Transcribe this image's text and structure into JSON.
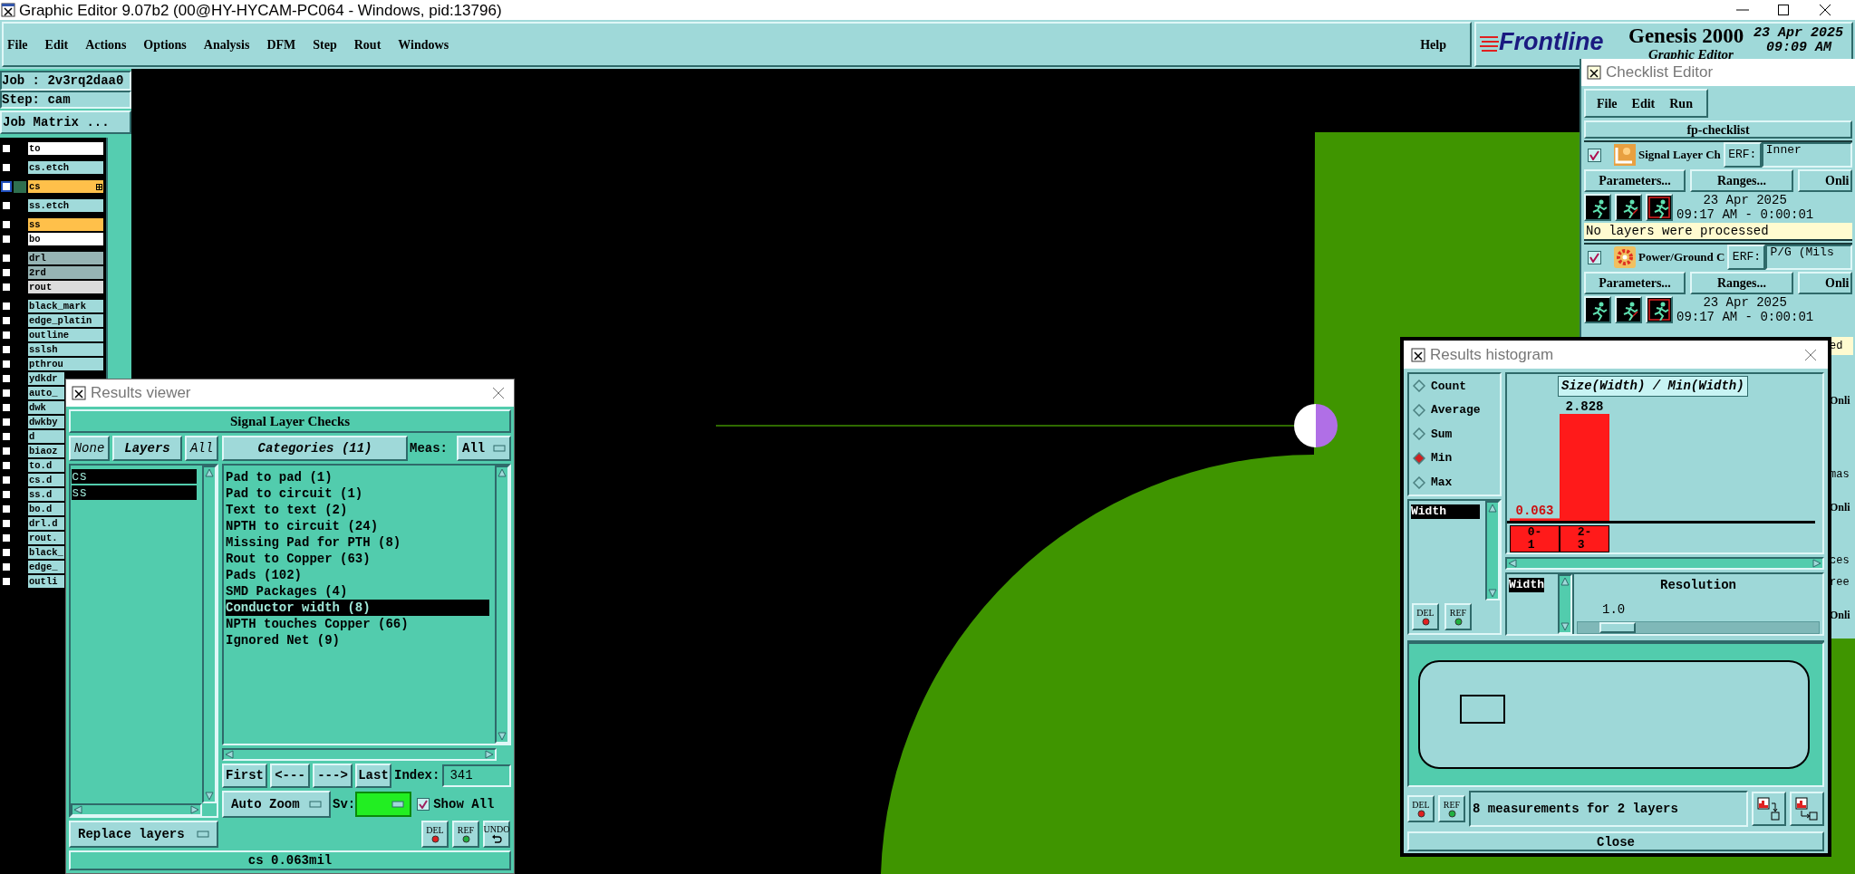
{
  "window": {
    "title": "Graphic Editor 9.07b2 (00@HY-HYCAM-PC064 - Windows, pid:13796)"
  },
  "menu": [
    "File",
    "Edit",
    "Actions",
    "Options",
    "Analysis",
    "DFM",
    "Step",
    "Rout",
    "Windows"
  ],
  "help": "Help",
  "brand": {
    "logo": "Frontline",
    "product": "Genesis 2000",
    "subtitle": "Graphic Editor",
    "date": "23 Apr 2025",
    "time": "09:09 AM"
  },
  "job": {
    "job": "Job : 2v3rq2daa0",
    "step": "Step: cam",
    "matrix_button": "Job Matrix ..."
  },
  "layer_groups": [
    [
      {
        "name": "to",
        "color": "#ffffff",
        "active": false,
        "checked": false
      }
    ],
    [
      {
        "name": "cs.etch",
        "color": "#a0dada",
        "active": false,
        "checked": false
      }
    ],
    [
      {
        "name": "cs",
        "color": "#ffc04a",
        "active": true,
        "checked": false
      }
    ],
    [
      {
        "name": "ss.etch",
        "color": "#a0dada",
        "active": false,
        "checked": false
      }
    ],
    [
      {
        "name": "ss",
        "color": "#ffc04a",
        "active": false,
        "checked": false
      },
      {
        "name": "bo",
        "color": "#ffffff",
        "active": false,
        "checked": false
      }
    ],
    [
      {
        "name": "drl",
        "color": "#96b4b4",
        "active": false,
        "checked": false
      },
      {
        "name": "2rd",
        "color": "#96b4b4",
        "active": false,
        "checked": false
      },
      {
        "name": "rout",
        "color": "#dcdcdc",
        "active": false,
        "checked": false
      }
    ],
    [
      {
        "name": "black_mark",
        "color": "#a0dada",
        "active": false,
        "checked": false
      },
      {
        "name": "edge_platin",
        "color": "#a0dada",
        "active": false,
        "checked": false
      },
      {
        "name": "outline",
        "color": "#a0dada",
        "active": false,
        "checked": false
      },
      {
        "name": "sslsh",
        "color": "#a0dada",
        "active": false,
        "checked": false
      },
      {
        "name": "pthrou",
        "color": "#a0dada",
        "active": false,
        "checked": false
      },
      {
        "name": "ydkdr",
        "color": "#a0dada",
        "active": false,
        "checked": false
      },
      {
        "name": "auto_",
        "color": "#a0dada",
        "active": false,
        "checked": false
      },
      {
        "name": "dwk",
        "color": "#a0dada",
        "active": false,
        "checked": false
      },
      {
        "name": "dwkby",
        "color": "#a0dada",
        "active": false,
        "checked": false
      },
      {
        "name": "d",
        "color": "#a0dada",
        "active": false,
        "checked": false
      },
      {
        "name": "biaoz",
        "color": "#a0dada",
        "active": false,
        "checked": false
      },
      {
        "name": "to.d",
        "color": "#a0dada",
        "active": false,
        "checked": false
      },
      {
        "name": "cs.d",
        "color": "#a0dada",
        "active": false,
        "checked": false
      },
      {
        "name": "ss.d",
        "color": "#a0dada",
        "active": false,
        "checked": false
      },
      {
        "name": "bo.d",
        "color": "#a0dada",
        "active": false,
        "checked": false
      },
      {
        "name": "drl.d",
        "color": "#a0dada",
        "active": false,
        "checked": false
      },
      {
        "name": "rout.",
        "color": "#a0dada",
        "active": false,
        "checked": false
      },
      {
        "name": "black_",
        "color": "#a0dada",
        "active": false,
        "checked": false
      },
      {
        "name": "edge_",
        "color": "#a0dada",
        "active": false,
        "checked": false
      },
      {
        "name": "outli",
        "color": "#a0dada",
        "active": false,
        "checked": false
      }
    ]
  ],
  "checklist_editor": {
    "title": "Checklist Editor",
    "menu": [
      "File",
      "Edit",
      "Run"
    ],
    "name": "fp-checklist",
    "checks": [
      {
        "kind": "signal",
        "checked": true,
        "name": "Signal Layer Ch",
        "erf_label": "ERF:",
        "erf_value": "Inner",
        "buttons": [
          "Parameters...",
          "Ranges...",
          "Onli"
        ],
        "date": "23 Apr 2025",
        "time": "09:17 AM - 0:00:01",
        "status": "No layers were processed"
      },
      {
        "kind": "power",
        "checked": true,
        "name": "Power/Ground C",
        "erf_label": "ERF:",
        "erf_value": "P/G (Mils",
        "buttons": [
          "Parameters...",
          "Ranges...",
          "Onli"
        ],
        "date": "23 Apr 2025",
        "time": "09:17 AM - 0:00:01"
      }
    ],
    "partial_texts": [
      "ed",
      "Onli",
      "mas",
      "Onli",
      "ces",
      "ree",
      "Onli"
    ]
  },
  "results_viewer": {
    "title": "Results viewer",
    "check_name": "Signal Layer Checks",
    "layer_buttons": [
      "None",
      "Layers",
      "All"
    ],
    "layers": [
      {
        "name": "cs",
        "selected": true
      },
      {
        "name": "ss",
        "selected": true
      }
    ],
    "categories_button": "Categories (11)",
    "meas_label": "Meas:",
    "meas_value": "All",
    "categories": [
      {
        "label": "Pad to pad (1)",
        "selected": false
      },
      {
        "label": "Pad to circuit (1)",
        "selected": false
      },
      {
        "label": "Text to text (2)",
        "selected": false
      },
      {
        "label": "NPTH to circuit (24)",
        "selected": false
      },
      {
        "label": "Missing Pad for PTH (8)",
        "selected": false
      },
      {
        "label": "Rout to Copper (63)",
        "selected": false
      },
      {
        "label": "Pads (102)",
        "selected": false
      },
      {
        "label": "SMD Packages (4)",
        "selected": false
      },
      {
        "label": "Conductor width (8)",
        "selected": true
      },
      {
        "label": "NPTH touches Copper (66)",
        "selected": false
      },
      {
        "label": "Ignored Net (9)",
        "selected": false
      }
    ],
    "nav_buttons": [
      "First",
      "<---",
      "--->",
      "Last"
    ],
    "index_label": "Index:",
    "index_value": "341",
    "zoom_mode": "Auto Zoom",
    "sv_label": "Sv:",
    "show_all": {
      "label": "Show All",
      "checked": true
    },
    "replace_mode": "Replace layers",
    "action_buttons": [
      "DEL",
      "REF",
      "UNDO"
    ],
    "status": "cs 0.063mil"
  },
  "results_histogram": {
    "title": "Results histogram",
    "measures": [
      {
        "label": "Count",
        "selected": false
      },
      {
        "label": "Average",
        "selected": false
      },
      {
        "label": "Sum",
        "selected": false
      },
      {
        "label": "Min",
        "selected": true
      },
      {
        "label": "Max",
        "selected": false
      }
    ],
    "attributes": [
      {
        "label": "Width",
        "selected": true
      }
    ],
    "attribute_buttons": [
      "DEL",
      "REF"
    ],
    "chart_data": {
      "type": "bar",
      "title": "Size(Width) / Min(Width)",
      "categories": [
        "0-1",
        "2-3"
      ],
      "values": [
        0.063,
        2.828
      ],
      "data_labels": true
    },
    "resolution_attributes": [
      {
        "label": "Width",
        "selected": true
      }
    ],
    "resolution_label": "Resolution",
    "resolution_value": "1.0",
    "resolution": {
      "level": 0.09
    },
    "measure_buttons": [
      "DEL",
      "REF"
    ],
    "summary": "8 measurements for 2 layers",
    "close": "Close"
  }
}
